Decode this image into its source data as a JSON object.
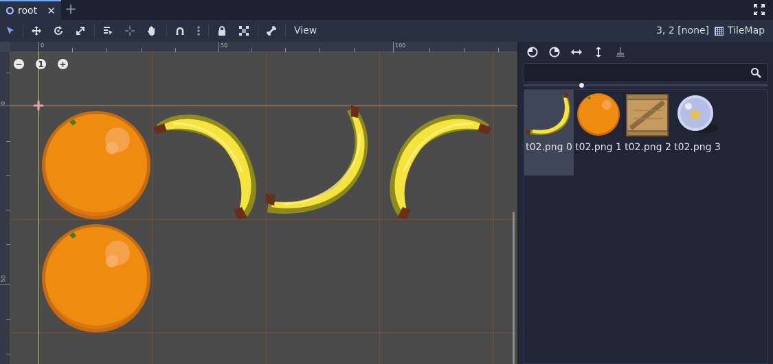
{
  "tabs": [
    {
      "label": "root",
      "icon": "scene-node-icon",
      "close_symbol": "✕"
    }
  ],
  "tab_add_symbol": "+",
  "toolbar": {
    "tools": [
      {
        "name": "select-mode",
        "icon": "cursor-arrow-icon"
      },
      {
        "name": "move-mode",
        "icon": "move-arrows-icon"
      },
      {
        "name": "rotate-mode",
        "icon": "rotate-icon"
      },
      {
        "name": "scale-mode",
        "icon": "scale-icon"
      },
      {
        "name": "list-select",
        "icon": "list-select-icon"
      },
      {
        "name": "pivot",
        "icon": "pivot-icon"
      },
      {
        "name": "pan-mode",
        "icon": "hand-icon"
      },
      {
        "name": "snap-toggle",
        "icon": "magnet-icon"
      },
      {
        "name": "snap-options",
        "icon": "vertical-dots-icon"
      },
      {
        "name": "lock",
        "icon": "lock-icon"
      },
      {
        "name": "group",
        "icon": "group-icon"
      },
      {
        "name": "skeleton",
        "icon": "bone-icon"
      }
    ],
    "view_label": "View",
    "coords_readout": "3, 2 [none]",
    "tilemap_label": "TileMap"
  },
  "rulers": {
    "top_labels": [
      "0",
      "50",
      "100"
    ],
    "left_labels": [
      "0",
      "50"
    ]
  },
  "zoom": {
    "zoom_out": "−",
    "reset": "1",
    "zoom_in": "+"
  },
  "canvas_tiles": [
    {
      "tile": "orange",
      "cell": "0,0"
    },
    {
      "tile": "banana",
      "cell": "1,0"
    },
    {
      "tile": "banana",
      "cell": "2,0"
    },
    {
      "tile": "banana",
      "cell": "3,0"
    },
    {
      "tile": "orange",
      "cell": "0,1"
    }
  ],
  "palette": {
    "tools": [
      {
        "name": "rotate-left",
        "icon": "rotate-left-icon"
      },
      {
        "name": "rotate-right",
        "icon": "rotate-right-icon"
      },
      {
        "name": "flip-horizontal",
        "icon": "flip-horizontal-icon"
      },
      {
        "name": "flip-vertical",
        "icon": "flip-vertical-icon"
      },
      {
        "name": "clear-transform",
        "icon": "clear-transform-icon"
      }
    ],
    "search_placeholder": "",
    "items": [
      {
        "label": "t02.png 0",
        "thumb": "banana",
        "selected": true
      },
      {
        "label": "t02.png 1",
        "thumb": "orange",
        "selected": false
      },
      {
        "label": "t02.png 2",
        "thumb": "crate",
        "selected": false
      },
      {
        "label": "t02.png 3",
        "thumb": "crystal-ball",
        "selected": false
      }
    ]
  },
  "colors": {
    "accent": "#6fa8ff",
    "viewport_bg": "#4b4b4b",
    "grid_line": "#a85234",
    "panel_bg": "#222838"
  }
}
